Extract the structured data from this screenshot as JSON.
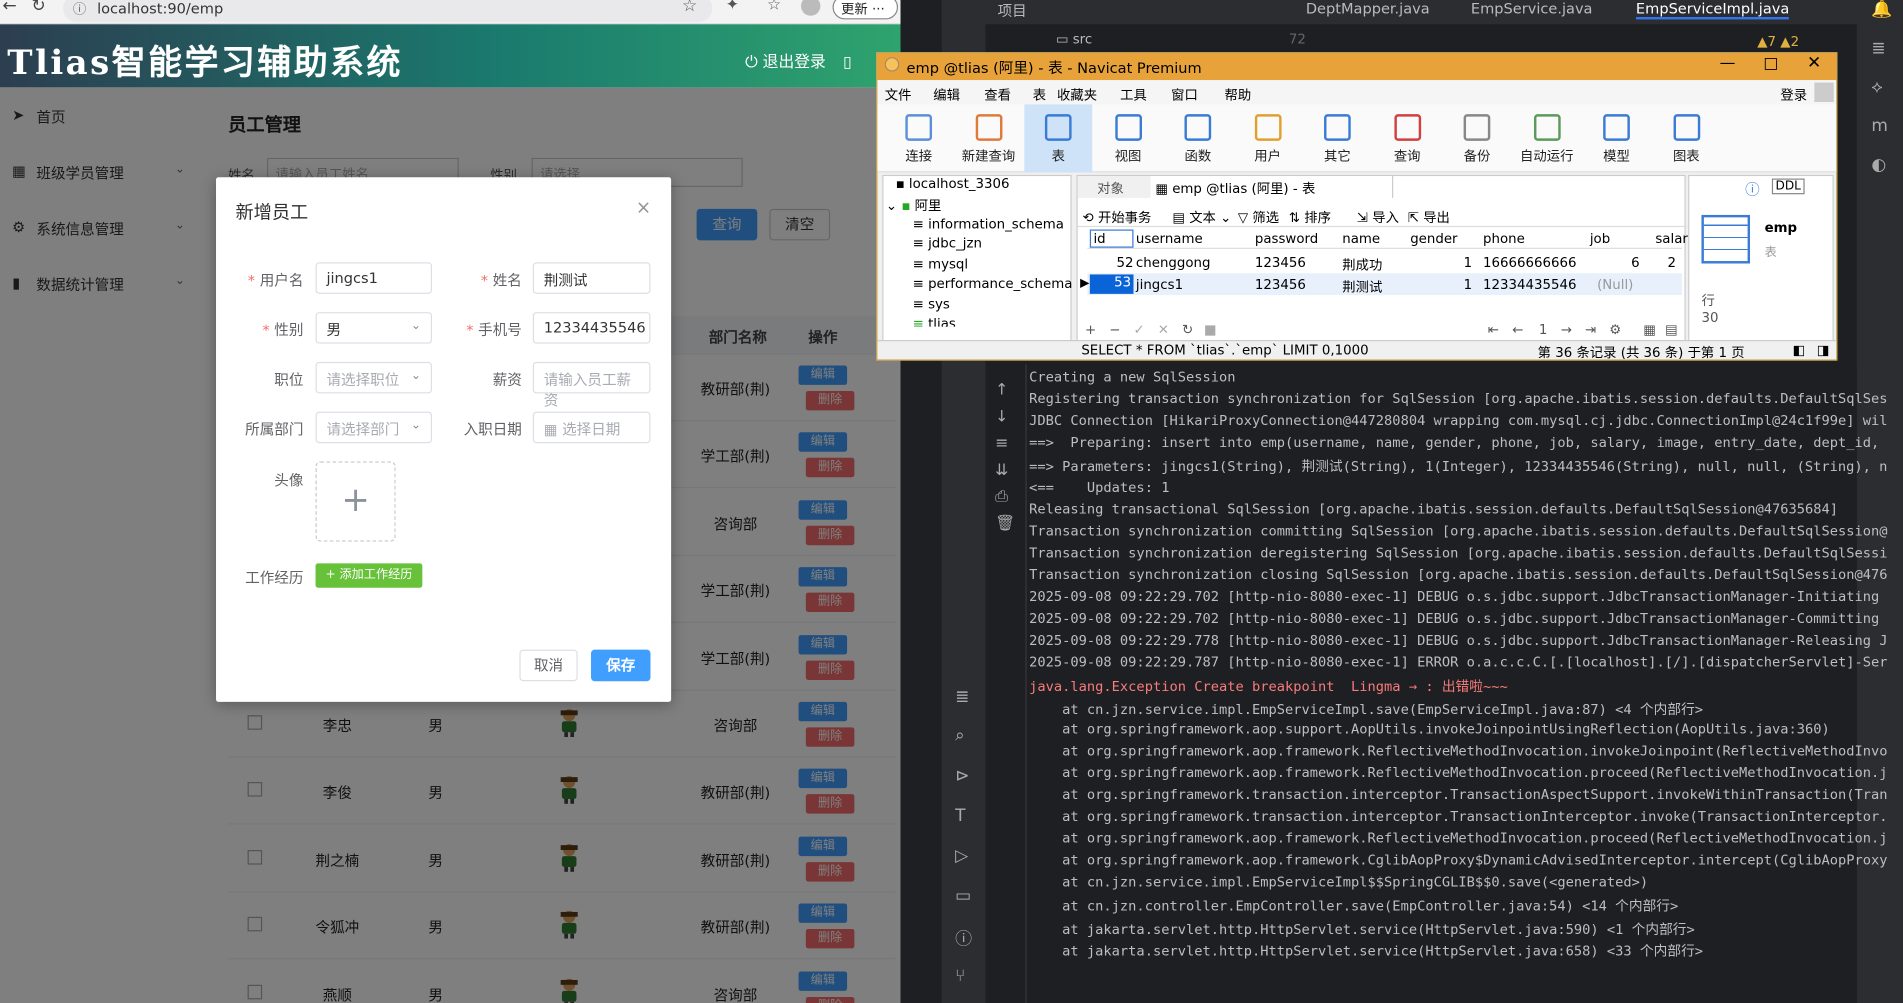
{
  "browser": {
    "url": "localhost:90/emp",
    "update_label": "更新"
  },
  "app": {
    "title": "Tlias智能学习辅助系统",
    "logout": "退出登录"
  },
  "sidebar": {
    "items": [
      {
        "label": "首页",
        "icon": "send-icon"
      },
      {
        "label": "班级学员管理",
        "icon": "grid-icon"
      },
      {
        "label": "系统信息管理",
        "icon": "gear-icon"
      },
      {
        "label": "数据统计管理",
        "icon": "bar-chart-icon"
      }
    ]
  },
  "page": {
    "title": "员工管理",
    "search_name_label": "姓名",
    "search_name_placeholder": "请输入员工姓名",
    "search_gender_label": "性别",
    "search_gender_placeholder": "请选择",
    "query_button": "查询",
    "clear_button": "清空",
    "col_department": "部门名称",
    "col_actions": "操作",
    "edit_label": "编辑",
    "delete_label": "删除"
  },
  "table": {
    "rows": [
      {
        "name": "",
        "gender": "",
        "dept": "教研部(荆)"
      },
      {
        "name": "",
        "gender": "",
        "dept": "学工部(荆)"
      },
      {
        "name": "",
        "gender": "",
        "dept": "咨询部"
      },
      {
        "name": "",
        "gender": "",
        "dept": "学工部(荆)"
      },
      {
        "name": "",
        "gender": "",
        "dept": "学工部(荆)"
      },
      {
        "name": "李忠",
        "gender": "男",
        "dept": "咨询部"
      },
      {
        "name": "李俊",
        "gender": "男",
        "dept": "教研部(荆)"
      },
      {
        "name": "荆之楠",
        "gender": "男",
        "dept": "教研部(荆)"
      },
      {
        "name": "令狐冲",
        "gender": "男",
        "dept": "教研部(荆)"
      },
      {
        "name": "燕顺",
        "gender": "男",
        "dept": "咨询部"
      }
    ]
  },
  "dialog": {
    "title": "新增员工",
    "username_label": "用户名",
    "username_value": "jingcs1",
    "name_label": "姓名",
    "name_value": "荆测试",
    "gender_label": "性别",
    "gender_value": "男",
    "phone_label": "手机号",
    "phone_value": "12334435546",
    "job_label": "职位",
    "job_placeholder": "请选择职位",
    "salary_label": "薪资",
    "salary_placeholder": "请输入员工薪资",
    "dept_label": "所属部门",
    "dept_placeholder": "请选择部门",
    "entry_label": "入职日期",
    "entry_placeholder": "选择日期",
    "avatar_label": "头像",
    "exp_label": "工作经历",
    "add_exp_button": "+ 添加工作经历",
    "cancel_button": "取消",
    "save_button": "保存"
  },
  "ide": {
    "project_label": "项目",
    "src_label": "src",
    "tabs": [
      "DeptMapper.java",
      "EmpService.java",
      "EmpServiceImpl.java"
    ],
    "warnings": "▲7 ▲2",
    "line_number": "72"
  },
  "navicat": {
    "title": "emp @tlias (阿里) - 表 - Navicat Premium",
    "menu": [
      "文件",
      "编辑",
      "查看",
      "表",
      "收藏夹",
      "工具",
      "窗口",
      "帮助"
    ],
    "login": "登录",
    "toolbar": [
      "连接",
      "新建查询",
      "表",
      "视图",
      "函数",
      "用户",
      "其它",
      "查询",
      "备份",
      "自动运行",
      "模型",
      "图表"
    ],
    "tree": [
      "localhost_3306",
      "阿里",
      "information_schema",
      "jdbc_jzn",
      "mysql",
      "performance_schema",
      "sys",
      "tlias"
    ],
    "object_tab": "对象",
    "table_tab": "emp @tlias (阿里) - 表",
    "actions": [
      "开始事务",
      "文本",
      "筛选",
      "排序",
      "导入",
      "导出"
    ],
    "columns": [
      "id",
      "username",
      "password",
      "name",
      "gender",
      "phone",
      "job",
      "salar"
    ],
    "rows": [
      {
        "id": "52",
        "username": "chenggong",
        "password": "123456",
        "name": "荆成功",
        "gender": "1",
        "phone": "16666666666",
        "job": "6",
        "salary": "2"
      },
      {
        "id": "53",
        "username": "jingcs1",
        "password": "123456",
        "name": "荆测试",
        "gender": "1",
        "phone": "12334435546",
        "job": "(Null)",
        "salary": ""
      }
    ],
    "page_number": "1",
    "info_name": "emp",
    "info_type": "表",
    "info_rows_label": "行",
    "info_rows_value": "30",
    "sql": "SELECT * FROM `tlias`.`emp` LIMIT 0,1000",
    "record_info": "第 36 条记录 (共 36 条) 于第 1 页"
  },
  "console": {
    "lines": [
      {
        "text": "Creating a new SqlSession",
        "type": "normal"
      },
      {
        "text": "Registering transaction synchronization for SqlSession [org.apache.ibatis.session.defaults.DefaultSqlSes",
        "type": "normal"
      },
      {
        "text": "JDBC Connection [HikariProxyConnection@447280804 wrapping com.mysql.cj.jdbc.ConnectionImpl@24c1f99e] wil",
        "type": "normal"
      },
      {
        "text": "==>  Preparing: insert into emp(username, name, gender, phone, job, salary, image, entry_date, dept_id,",
        "type": "normal"
      },
      {
        "text": "==> Parameters: jingcs1(String), 荆测试(String), 1(Integer), 12334435546(String), null, null, (String), n",
        "type": "normal"
      },
      {
        "text": "<==    Updates: 1",
        "type": "normal"
      },
      {
        "text": "Releasing transactional SqlSession [org.apache.ibatis.session.defaults.DefaultSqlSession@47635684]",
        "type": "normal"
      },
      {
        "text": "Transaction synchronization committing SqlSession [org.apache.ibatis.session.defaults.DefaultSqlSession@",
        "type": "normal"
      },
      {
        "text": "Transaction synchronization deregistering SqlSession [org.apache.ibatis.session.defaults.DefaultSqlSessi",
        "type": "normal"
      },
      {
        "text": "Transaction synchronization closing SqlSession [org.apache.ibatis.session.defaults.DefaultSqlSession@476",
        "type": "normal"
      },
      {
        "text": "2025-09-08 09:22:29.702 [http-nio-8080-exec-1] DEBUG o.s.jdbc.support.JdbcTransactionManager-Initiating",
        "type": "normal"
      },
      {
        "text": "2025-09-08 09:22:29.702 [http-nio-8080-exec-1] DEBUG o.s.jdbc.support.JdbcTransactionManager-Committing",
        "type": "normal"
      },
      {
        "text": "2025-09-08 09:22:29.778 [http-nio-8080-exec-1] DEBUG o.s.jdbc.support.JdbcTransactionManager-Releasing J",
        "type": "normal"
      },
      {
        "text": "2025-09-08 09:22:29.787 [http-nio-8080-exec-1] ERROR o.a.c.c.C.[.[localhost].[/].[dispatcherServlet]-Ser",
        "type": "normal"
      },
      {
        "text": "java.lang.Exception Create breakpoint  Lingma → : 出错啦~~~",
        "type": "err"
      },
      {
        "text": "    at cn.jzn.service.impl.EmpServiceImpl.save(EmpServiceImpl.java:87) <4 个内部行>",
        "type": "normal"
      },
      {
        "text": "    at org.springframework.aop.support.AopUtils.invokeJoinpointUsingReflection(AopUtils.java:360)",
        "type": "normal"
      },
      {
        "text": "    at org.springframework.aop.framework.ReflectiveMethodInvocation.invokeJoinpoint(ReflectiveMethodInvo",
        "type": "normal"
      },
      {
        "text": "    at org.springframework.aop.framework.ReflectiveMethodInvocation.proceed(ReflectiveMethodInvocation.j",
        "type": "normal"
      },
      {
        "text": "    at org.springframework.transaction.interceptor.TransactionAspectSupport.invokeWithinTransaction(Tran",
        "type": "normal"
      },
      {
        "text": "    at org.springframework.transaction.interceptor.TransactionInterceptor.invoke(TransactionInterceptor.",
        "type": "normal"
      },
      {
        "text": "    at org.springframework.aop.framework.ReflectiveMethodInvocation.proceed(ReflectiveMethodInvocation.j",
        "type": "normal"
      },
      {
        "text": "    at org.springframework.aop.framework.CglibAopProxy$DynamicAdvisedInterceptor.intercept(CglibAopProxy",
        "type": "normal"
      },
      {
        "text": "    at cn.jzn.service.impl.EmpServiceImpl$$SpringCGLIB$$0.save(<generated>)",
        "type": "normal"
      },
      {
        "text": "    at cn.jzn.controller.EmpController.save(EmpController.java:54) <14 个内部行>",
        "type": "normal"
      },
      {
        "text": "    at jakarta.servlet.http.HttpServlet.service(HttpServlet.java:590) <1 个内部行>",
        "type": "normal"
      },
      {
        "text": "    at jakarta.servlet.http.HttpServlet.service(HttpServlet.java:658) <33 个内部行>",
        "type": "normal"
      }
    ]
  },
  "colors": {
    "primary": "#409eff",
    "danger": "#f56c6c",
    "success": "#67c23a",
    "navicat_title": "#e8a23a",
    "ide_bg": "#1e1f22"
  }
}
